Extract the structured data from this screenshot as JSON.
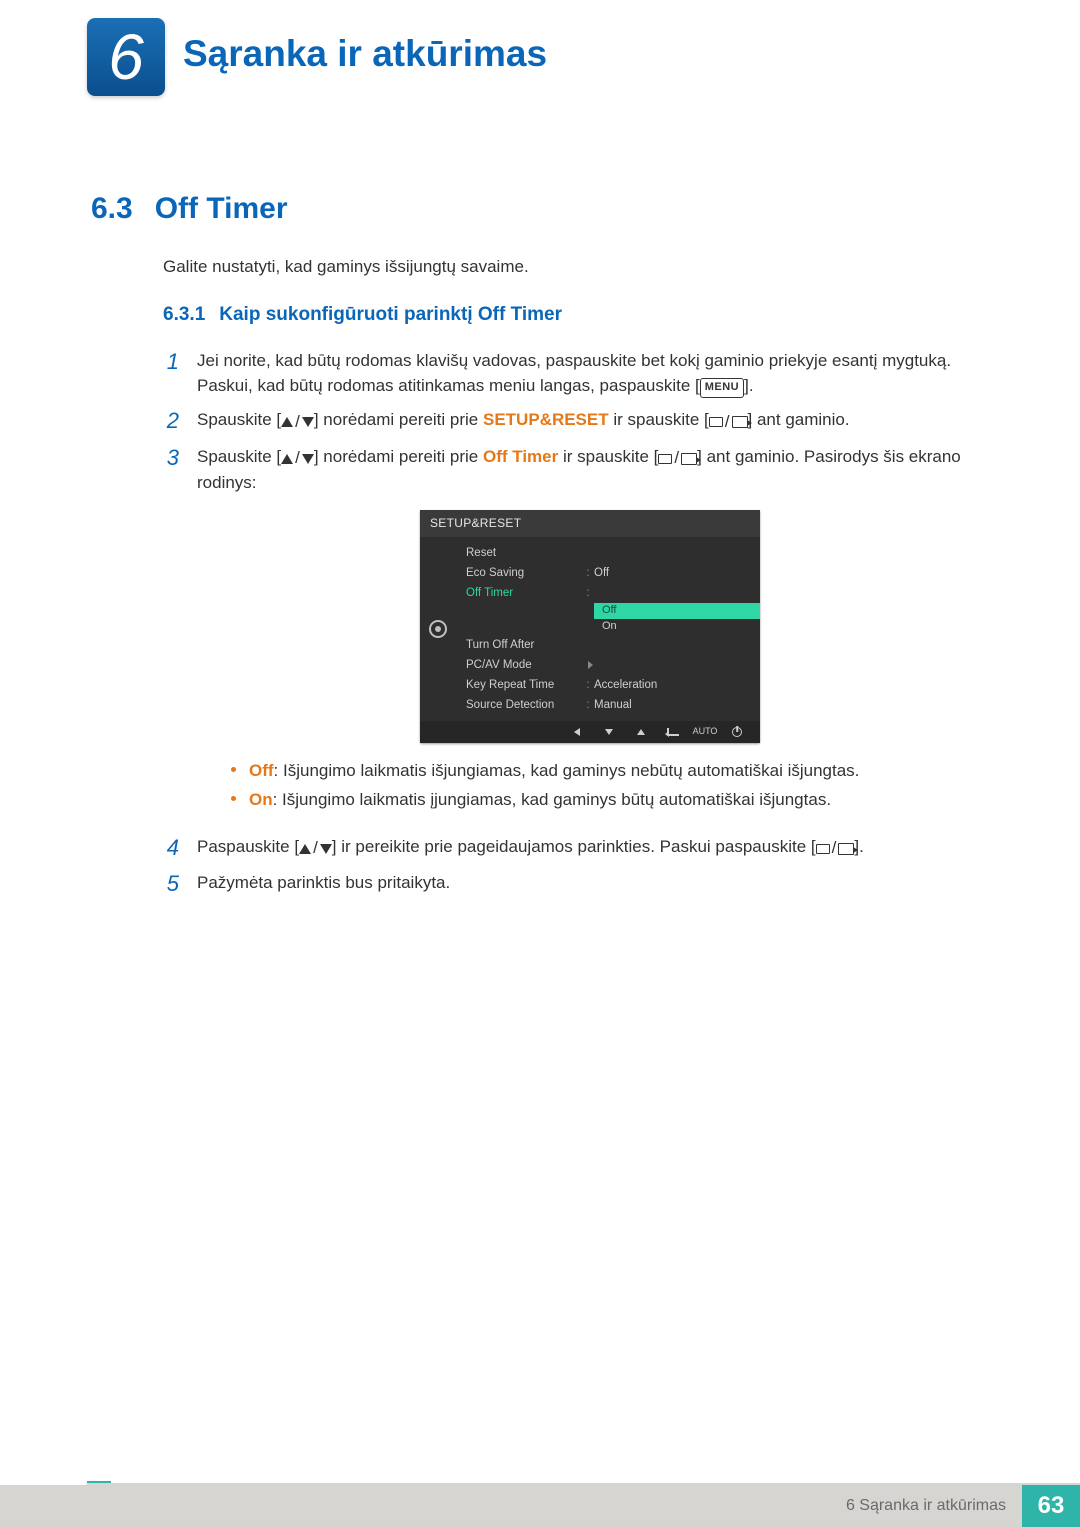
{
  "chapter": {
    "number": "6",
    "title": "Sąranka ir atkūrimas"
  },
  "section": {
    "number": "6.3",
    "title": "Off Timer"
  },
  "intro": "Galite nustatyti, kad gaminys išsijungtų savaime.",
  "subsection": {
    "number": "6.3.1",
    "title": "Kaip sukonfigūruoti parinktį Off Timer"
  },
  "steps": {
    "s1": {
      "num": "1",
      "line1": "Jei norite, kad būtų rodomas klavišų vadovas, paspauskite bet kokį gaminio priekyje esantį mygtuką.",
      "line2_a": "Paskui, kad būtų rodomas atitinkamas meniu langas, paspauskite [",
      "menu": "MENU",
      "line2_b": "]."
    },
    "s2": {
      "num": "2",
      "a": "Spauskite [",
      "b": "] norėdami pereiti prie ",
      "kw": "SETUP&RESET",
      "c": " ir spauskite [",
      "d": "] ant gaminio."
    },
    "s3": {
      "num": "3",
      "a": "Spauskite [",
      "b": "] norėdami pereiti prie ",
      "kw": "Off Timer",
      "c": " ir spauskite [",
      "d": "] ant gaminio. Pasirodys šis ekrano rodinys:"
    },
    "s4": {
      "num": "4",
      "a": "Paspauskite [",
      "b": "] ir pereikite prie pageidaujamos parinkties. Paskui paspauskite [",
      "c": "]."
    },
    "s5": {
      "num": "5",
      "text": "Pažymėta parinktis bus pritaikyta."
    }
  },
  "osd": {
    "title": "SETUP&RESET",
    "items": {
      "reset": "Reset",
      "eco": "Eco Saving",
      "eco_val": "Off",
      "offtimer": "Off Timer",
      "opt_off": "Off",
      "opt_on": "On",
      "turnoff": "Turn Off After",
      "pcav": "PC/AV Mode",
      "keyrep": "Key Repeat Time",
      "keyrep_val": "Acceleration",
      "srcdet": "Source Detection",
      "srcdet_val": "Manual"
    },
    "footer_auto": "AUTO"
  },
  "bullets": {
    "off_term": "Off",
    "off_text": ": Išjungimo laikmatis išjungiamas, kad gaminys nebūtų automatiškai išjungtas.",
    "on_term": "On",
    "on_text": ": Išjungimo laikmatis įjungiamas, kad gaminys būtų automatiškai išjungtas."
  },
  "footer": {
    "label": "6 Sąranka ir atkūrimas",
    "page": "63"
  }
}
